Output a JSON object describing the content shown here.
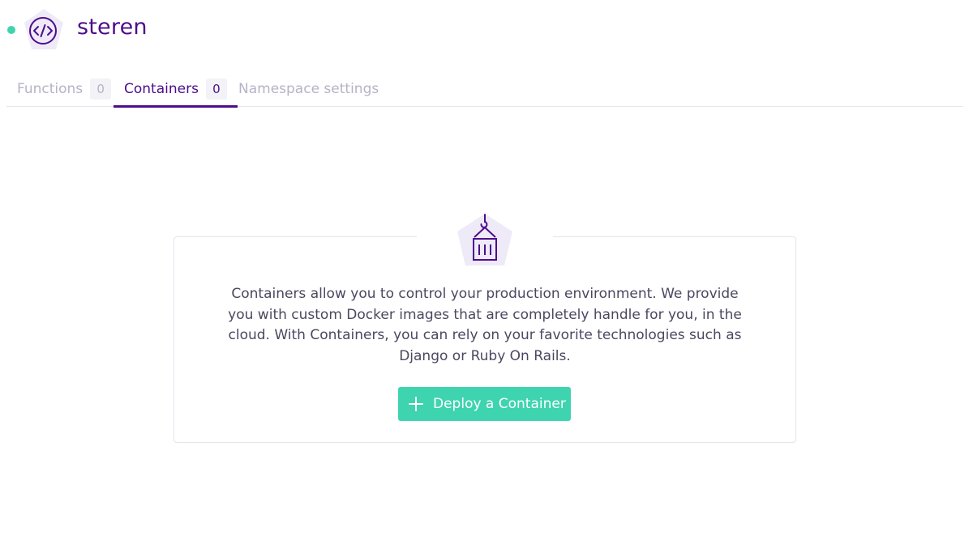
{
  "namespace": {
    "name": "steren",
    "status_color": "#3fd4b0",
    "icon": "code-icon"
  },
  "tabs": [
    {
      "label": "Functions",
      "count": "0",
      "active": false
    },
    {
      "label": "Containers",
      "count": "0",
      "active": true
    },
    {
      "label": "Namespace settings",
      "active": false
    }
  ],
  "empty_state": {
    "icon": "container-crane-icon",
    "description": "Containers allow you to control your production environment. We provide you with custom Docker images that are completely handle for you, in the cloud. With Containers, you can rely on your favorite technologies such as Django or Ruby On Rails.",
    "cta_label": "Deploy a Container",
    "cta_icon": "plus-icon"
  },
  "colors": {
    "brand_purple": "#4d0d8c",
    "accent_green": "#3fd4b0",
    "badge_bg": "#efeaf8",
    "muted_text": "#b5b3c6"
  }
}
